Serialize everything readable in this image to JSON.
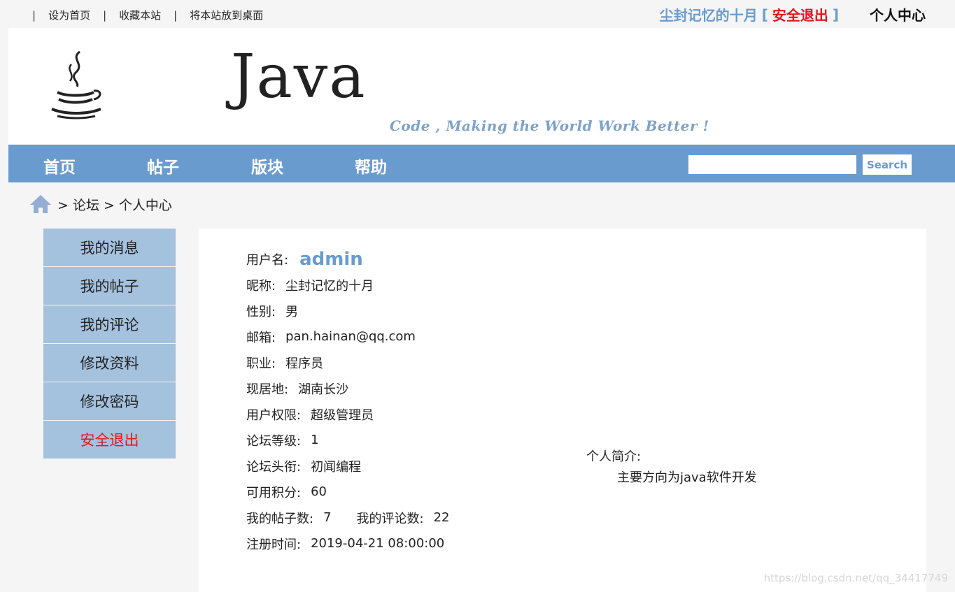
{
  "topbar": {
    "separator": "|",
    "links": [
      "设为首页",
      "收藏本站",
      "将本站放到桌面"
    ],
    "nickname": "尘封记忆的十月",
    "bracket_open": "[",
    "logout": "安全退出",
    "bracket_close": "]",
    "personal_center": "个人中心"
  },
  "banner": {
    "title": "Java",
    "slogan": "Code , Making the World Work Better !"
  },
  "nav": {
    "items": [
      "首页",
      "帖子",
      "版块",
      "帮助"
    ],
    "search_placeholder": "",
    "search_button": "Search"
  },
  "breadcrumb": {
    "home_icon": "home-icon",
    "parts": [
      "> 论坛",
      "> 个人中心"
    ]
  },
  "sidebar": {
    "items": [
      "我的消息",
      "我的帖子",
      "我的评论",
      "修改资料",
      "修改密码",
      "安全退出"
    ]
  },
  "profile": {
    "username_label": "用户名:",
    "username": "admin",
    "nickname_label": "昵称:",
    "nickname": "尘封记忆的十月",
    "gender_label": "性别:",
    "gender": "男",
    "email_label": "邮箱:",
    "email": "pan.hainan@qq.com",
    "job_label": "职业:",
    "job": "程序员",
    "location_label": "现居地:",
    "location": "湖南长沙",
    "permission_label": "用户权限:",
    "permission": "超级管理员",
    "level_label": "论坛等级:",
    "level": "1",
    "title_label": "论坛头衔:",
    "title": "初闻编程",
    "points_label": "可用积分:",
    "points": "60",
    "posts_label": "我的帖子数:",
    "posts": "7",
    "comments_label": "我的评论数:",
    "comments": "22",
    "register_label": "注册时间:",
    "register": "2019-04-21 08:00:00",
    "bio_label": "个人简介:",
    "bio": "主要方向为java软件开发"
  },
  "watermark": "https://blog.csdn.net/qq_34417749",
  "colors": {
    "accent": "#6a9bcf",
    "side_menu": "#a4c1de",
    "danger": "#e8141c",
    "background": "#f5f5f5"
  }
}
